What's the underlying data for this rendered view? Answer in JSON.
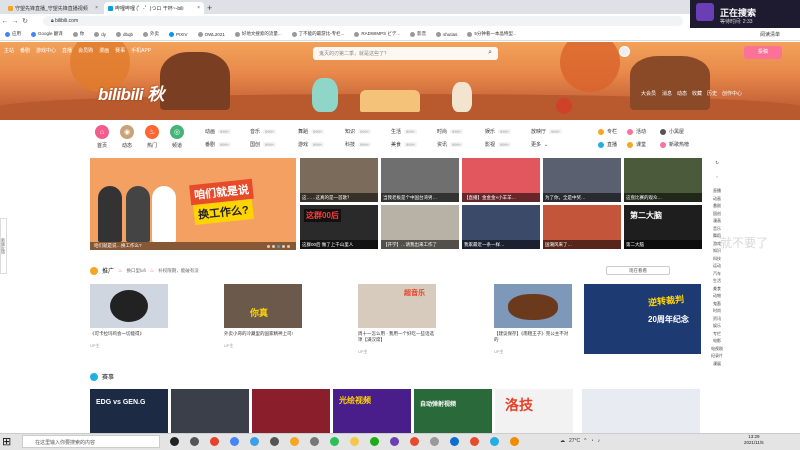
{
  "browser": {
    "tabs": [
      {
        "label": "守望先锋直播_守望先锋直播视频",
        "active": false
      },
      {
        "label": "哔哩哔哩 (゜-゜)つロ 干杯~-bili",
        "active": true
      }
    ],
    "new_tab": "+",
    "url": "bilibili.com",
    "bookmarks": [
      "应用",
      "Google 翻译",
      "你",
      "dy",
      "dbqb",
      "外卖",
      "PIXIV",
      "OWL2021",
      "好地文搜索的流量...",
      "丁不能的最游比-专栏...",
      "RADWIMPS ビデ...",
      "影音",
      "shutias",
      "5分钟看一本晶特型..."
    ],
    "reading_mode": "阅读清单"
  },
  "overlay": {
    "title": "正在搜索",
    "subtitle": "等待时间: 2:33"
  },
  "bili": {
    "top_nav": [
      "主站",
      "番剧",
      "游戏中心",
      "直播",
      "会员购",
      "漫画",
      "赛事",
      "手机APP"
    ],
    "logo_text": "bilibili 秋",
    "search_placeholder": "鬼灭的刃第二季，就是这些了？",
    "right_nav": [
      "大会员",
      "消息",
      "动态",
      "收藏",
      "历史",
      "创作中心"
    ],
    "upload": "投稿",
    "channels": [
      {
        "label": "首页",
        "color": "#f25d8e"
      },
      {
        "label": "动态",
        "color": "#fb7299"
      },
      {
        "label": "热门",
        "color": "#ff6633"
      },
      {
        "label": "频道",
        "color": "#44b478"
      }
    ],
    "categories": [
      {
        "label": "动画",
        "n": "999+"
      },
      {
        "label": "音乐",
        "n": "999+"
      },
      {
        "label": "舞蹈",
        "n": "999+"
      },
      {
        "label": "知识",
        "n": "999+"
      },
      {
        "label": "生活",
        "n": "999+"
      },
      {
        "label": "时尚",
        "n": "999+"
      },
      {
        "label": "娱乐",
        "n": "999+"
      },
      {
        "label": "放映厅",
        "n": "999+"
      },
      {
        "label": "番剧",
        "n": "999+"
      },
      {
        "label": "国创",
        "n": "999+"
      },
      {
        "label": "游戏",
        "n": "999+"
      },
      {
        "label": "科技",
        "n": "999+"
      },
      {
        "label": "美食",
        "n": "999+"
      },
      {
        "label": "资讯",
        "n": "999+"
      },
      {
        "label": "影视",
        "n": "999+"
      },
      {
        "label": "更多",
        "n": ""
      }
    ],
    "right_links": [
      {
        "label": "专栏",
        "color": "#f6a623"
      },
      {
        "label": "活动",
        "color": "#fb7299"
      },
      {
        "label": "小黑屋",
        "color": "#555"
      },
      {
        "label": "直播",
        "color": "#23ade5"
      },
      {
        "label": "课堂",
        "color": "#f6a623"
      },
      {
        "label": "新歌热榜",
        "color": "#fb7299"
      }
    ],
    "carousel_headline_1": "咱们就是说",
    "carousel_headline_2": "换工作么?",
    "carousel_caption": "咱们就是说…换工作么?",
    "thumbs": [
      "这……这真的是一首歌？",
      "当我老板是个中国台湾男…",
      "【直播】金金金×小羊羊…",
      "为了你，全是中奖…",
      "这盘比赛的观众…",
      "这群00后 做了上千山里人",
      "【开学】…请我出来工作了",
      "我家最近一条一样…",
      "国潮风来了…",
      "第二大脑"
    ],
    "ghost_text": "就不要了",
    "side_tabs": [
      "直播",
      "动画",
      "番剧",
      "国创",
      "漫画",
      "音乐",
      "舞蹈",
      "游戏",
      "知识",
      "科技",
      "运动",
      "汽车",
      "生活",
      "美食",
      "动物",
      "鬼畜",
      "时尚",
      "资讯",
      "娱乐",
      "专栏",
      "电影",
      "电视剧",
      "纪录片",
      "漫展"
    ],
    "feedback": "新版反馈",
    "promo": {
      "title": "推广",
      "note1": "换口型lofi",
      "note2": "补权限期，能破有没",
      "more_button": "现在看看",
      "cards": [
        {
          "title": "《可卡拉玛鸡会一切能得》",
          "up": "UP主"
        },
        {
          "title": "外卖小哥的冷藏里的国家精神上司!",
          "up": "UP主"
        },
        {
          "title": "周十一怎么用 · 我用一个好吃一些话选项【满汉席】",
          "up": "UP主"
        },
        {
          "title": "【建议保存】《南粗王子》完公主不对的",
          "up": "UP主"
        }
      ],
      "promo_text_2": "你真",
      "promo_text_3": "超音乐",
      "ad_title": "逆转裁判",
      "ad_subtitle": "20周年纪念"
    },
    "esports": {
      "title": "赛事",
      "cards": [
        "EDG vs GEN.G",
        "",
        "",
        "光绘视频",
        "自动弹射视频",
        "洛技"
      ]
    }
  },
  "taskbar": {
    "search_placeholder": "在这里输入你要搜索的内容",
    "temperature": "27°C",
    "time": "13:29",
    "date": "2021/11/5"
  }
}
